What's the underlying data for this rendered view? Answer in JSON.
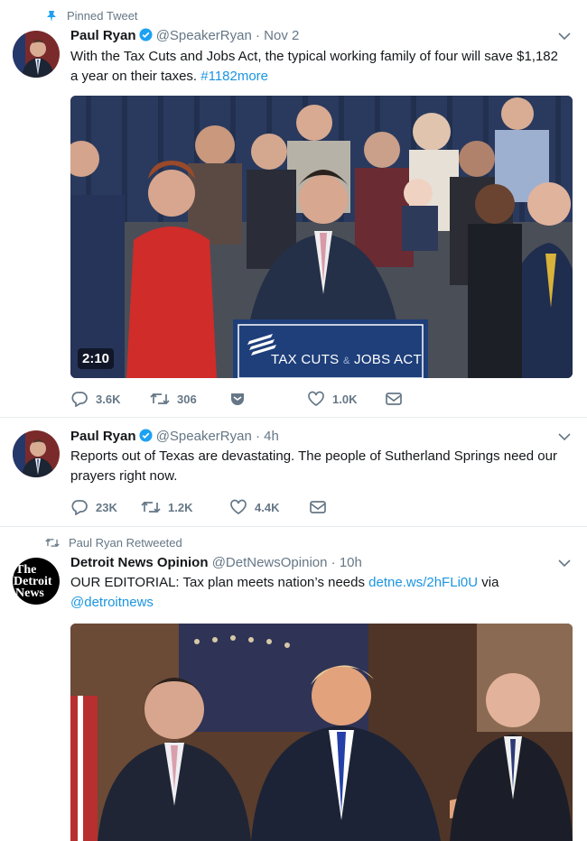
{
  "colors": {
    "link": "#1b95e0",
    "secondary_text": "#657786",
    "divider": "#e6ecf0",
    "verified": "#1da1f2"
  },
  "tweets": [
    {
      "context": "Pinned Tweet",
      "context_icon": "pin-icon",
      "author_name": "Paul Ryan",
      "verified": true,
      "handle": "@SpeakerRyan",
      "separator": "·",
      "time": "Nov 2",
      "text_plain": "With the Tax Cuts and Jobs Act, the typical working family of four will save $1,182 a year on their taxes.",
      "hashtag": "#1182more",
      "video": {
        "duration": "2:10",
        "podium_text_left": "TAX CUTS",
        "podium_text_amp": "&",
        "podium_text_right": "JOBS ACT"
      },
      "actions": {
        "replies": "3.6K",
        "retweets": "306",
        "likes": "1.0K"
      }
    },
    {
      "author_name": "Paul Ryan",
      "verified": true,
      "handle": "@SpeakerRyan",
      "separator": "·",
      "time": "4h",
      "text": "Reports out of Texas are devastating. The people of Sutherland Springs need our prayers right now.",
      "actions": {
        "replies": "23K",
        "retweets": "1.2K",
        "likes": "4.4K"
      }
    },
    {
      "context": "Paul Ryan Retweeted",
      "context_icon": "retweet-icon",
      "author_name": "Detroit News Opinion",
      "avatar_text": [
        "The",
        "Detroit",
        "News"
      ],
      "handle": "@DetNewsOpinion",
      "separator": "·",
      "time": "10h",
      "text_plain": "OUR EDITORIAL: Tax plan meets nation’s needs",
      "link": "detne.ws/2hFLi0U",
      "via": "via",
      "mention": "@detroitnews"
    }
  ]
}
